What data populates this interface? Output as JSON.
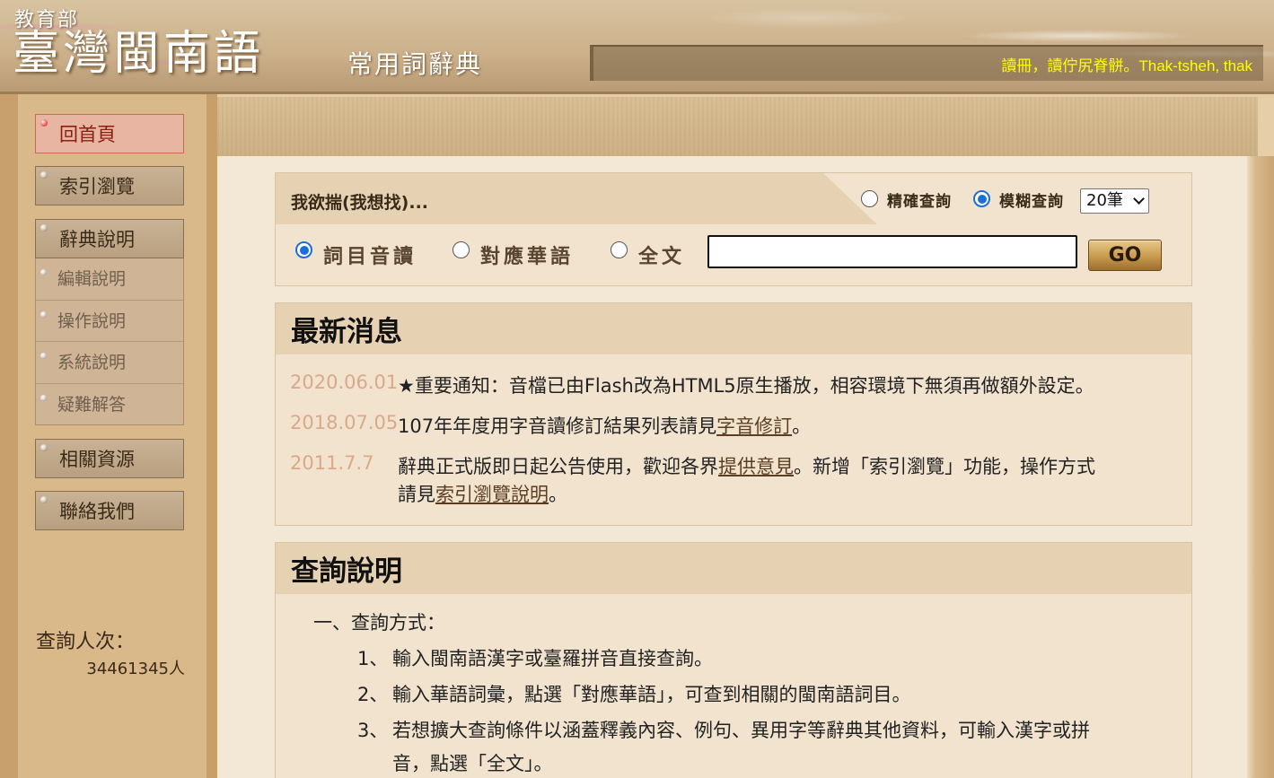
{
  "header": {
    "ministry": "教育部",
    "title": "臺灣閩南語",
    "subtitle": "常用詞辭典",
    "proverb": "讀冊，讀佇尻脊骿。Thak-tsheh, thak"
  },
  "sidebar": {
    "items": [
      {
        "label": "回首頁"
      },
      {
        "label": "索引瀏覽"
      },
      {
        "label": "辭典說明"
      },
      {
        "label": "相關資源"
      },
      {
        "label": "聯絡我們"
      }
    ],
    "sub_items": [
      {
        "label": "編輯說明"
      },
      {
        "label": "操作說明"
      },
      {
        "label": "系統說明"
      },
      {
        "label": "疑難解答"
      }
    ],
    "visits_label": "查詢人次：",
    "visits_count": "34461345人"
  },
  "search": {
    "prompt": "我欲揣(我想找)...",
    "mode_exact": "精確查詢",
    "mode_fuzzy": "模糊查詢",
    "result_count": "20筆",
    "scope_entry": "詞目音讀",
    "scope_mandarin": "對應華語",
    "scope_fulltext": "全文",
    "input_value": "",
    "go_label": "GO"
  },
  "news": {
    "title": "最新消息",
    "items": [
      {
        "date": "2020.06.01",
        "text": "★重要通知：音檔已由Flash改為HTML5原生播放，相容環境下無須再做額外設定。"
      },
      {
        "date": "2018.07.05",
        "text_before": "107年年度用字音讀修訂結果列表請見",
        "link": "字音修訂",
        "text_after": "。"
      },
      {
        "date": "2011.7.7",
        "text_before": "辭典正式版即日起公告使用，歡迎各界",
        "link": "提供意見",
        "text_mid": "。新增「索引瀏覽」功能，操作方式",
        "line2_before": "請見",
        "link2": "索引瀏覽說明",
        "line2_after": "。"
      }
    ]
  },
  "help": {
    "title": "查詢說明",
    "section1": "一、查詢方式：",
    "items": [
      {
        "num": "1、",
        "text": "輸入閩南語漢字或臺羅拼音直接查詢。"
      },
      {
        "num": "2、",
        "text": "輸入華語詞彙，點選「對應華語」，可查到相關的閩南語詞目。"
      },
      {
        "num": "3、",
        "text": "若想擴大查詢條件以涵蓋釋義內容、例句、異用字等辭典其他資料，可輸入漢字或拼",
        "text2": "音，點選「全文」。"
      }
    ]
  }
}
